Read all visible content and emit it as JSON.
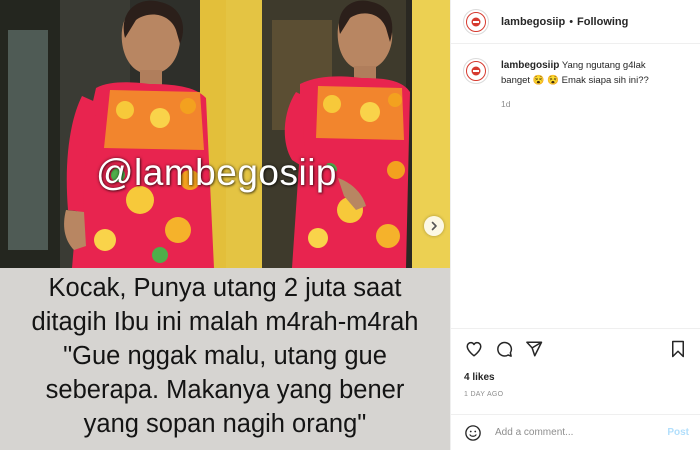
{
  "post": {
    "watermark": "@lambegosiip",
    "caption_lines": [
      "Kocak, Punya utang 2 juta saat",
      "ditagih Ibu ini malah m4rah-m4rah",
      "\"Gue nggak malu, utang gue",
      "seberapa. Makanya yang bener",
      "yang sopan nagih orang\""
    ]
  },
  "header": {
    "username": "lambegosiip",
    "separator": "•",
    "follow_status": "Following"
  },
  "comment": {
    "username": "lambegosiip",
    "text": "Yang ngutang g4lak banget 😵 😵 Emak siapa sih ini??",
    "time": "1d"
  },
  "actions": {
    "icons": [
      "heart-icon",
      "comment-icon",
      "share-icon",
      "bookmark-icon"
    ]
  },
  "likes": "4 likes",
  "posted": "1 DAY AGO",
  "add_comment": {
    "placeholder": "Add a comment...",
    "post_label": "Post"
  },
  "colors": {
    "accent": "#0095f6",
    "post_disabled": "#b2dffc",
    "dress": "#e8244f",
    "wall_yellow": "#e9c640",
    "caption_bg": "#d6d4d1"
  }
}
